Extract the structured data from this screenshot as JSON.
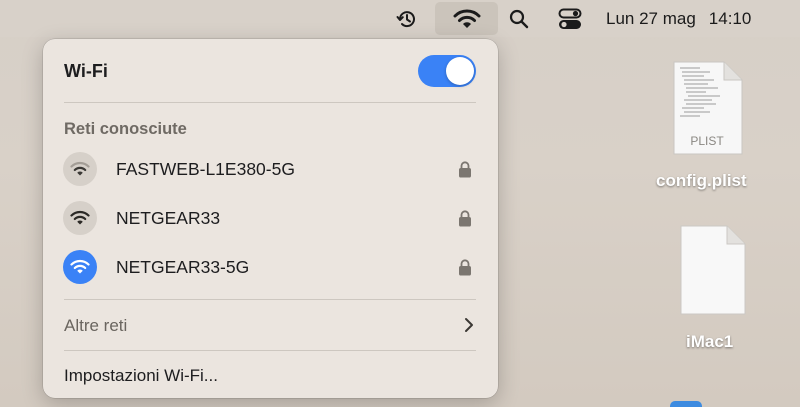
{
  "menubar": {
    "icons": [
      "time-machine-icon",
      "wifi-icon",
      "search-icon",
      "control-center-icon"
    ],
    "day": "Lun 27 mag",
    "time": "14:10"
  },
  "wifi_menu": {
    "title": "Wi-Fi",
    "toggle_on": true,
    "known_networks_label": "Reti conosciute",
    "networks": [
      {
        "name": "FASTWEB-L1E380-5G",
        "icon": "wifi-weak-icon",
        "locked": true,
        "connected": false
      },
      {
        "name": "NETGEAR33",
        "icon": "wifi-icon",
        "locked": true,
        "connected": false
      },
      {
        "name": "NETGEAR33-5G",
        "icon": "wifi-icon",
        "locked": true,
        "connected": true
      }
    ],
    "other_networks_label": "Altre reti",
    "settings_label": "Impostazioni Wi-Fi..."
  },
  "desktop": {
    "files": [
      {
        "name": "config.plist",
        "badge": "PLIST"
      },
      {
        "name": "iMac1"
      }
    ]
  },
  "colors": {
    "accent": "#3a82f6",
    "menu_bg": "#ebe5df",
    "desktop_bg": "#d6cfc7"
  }
}
